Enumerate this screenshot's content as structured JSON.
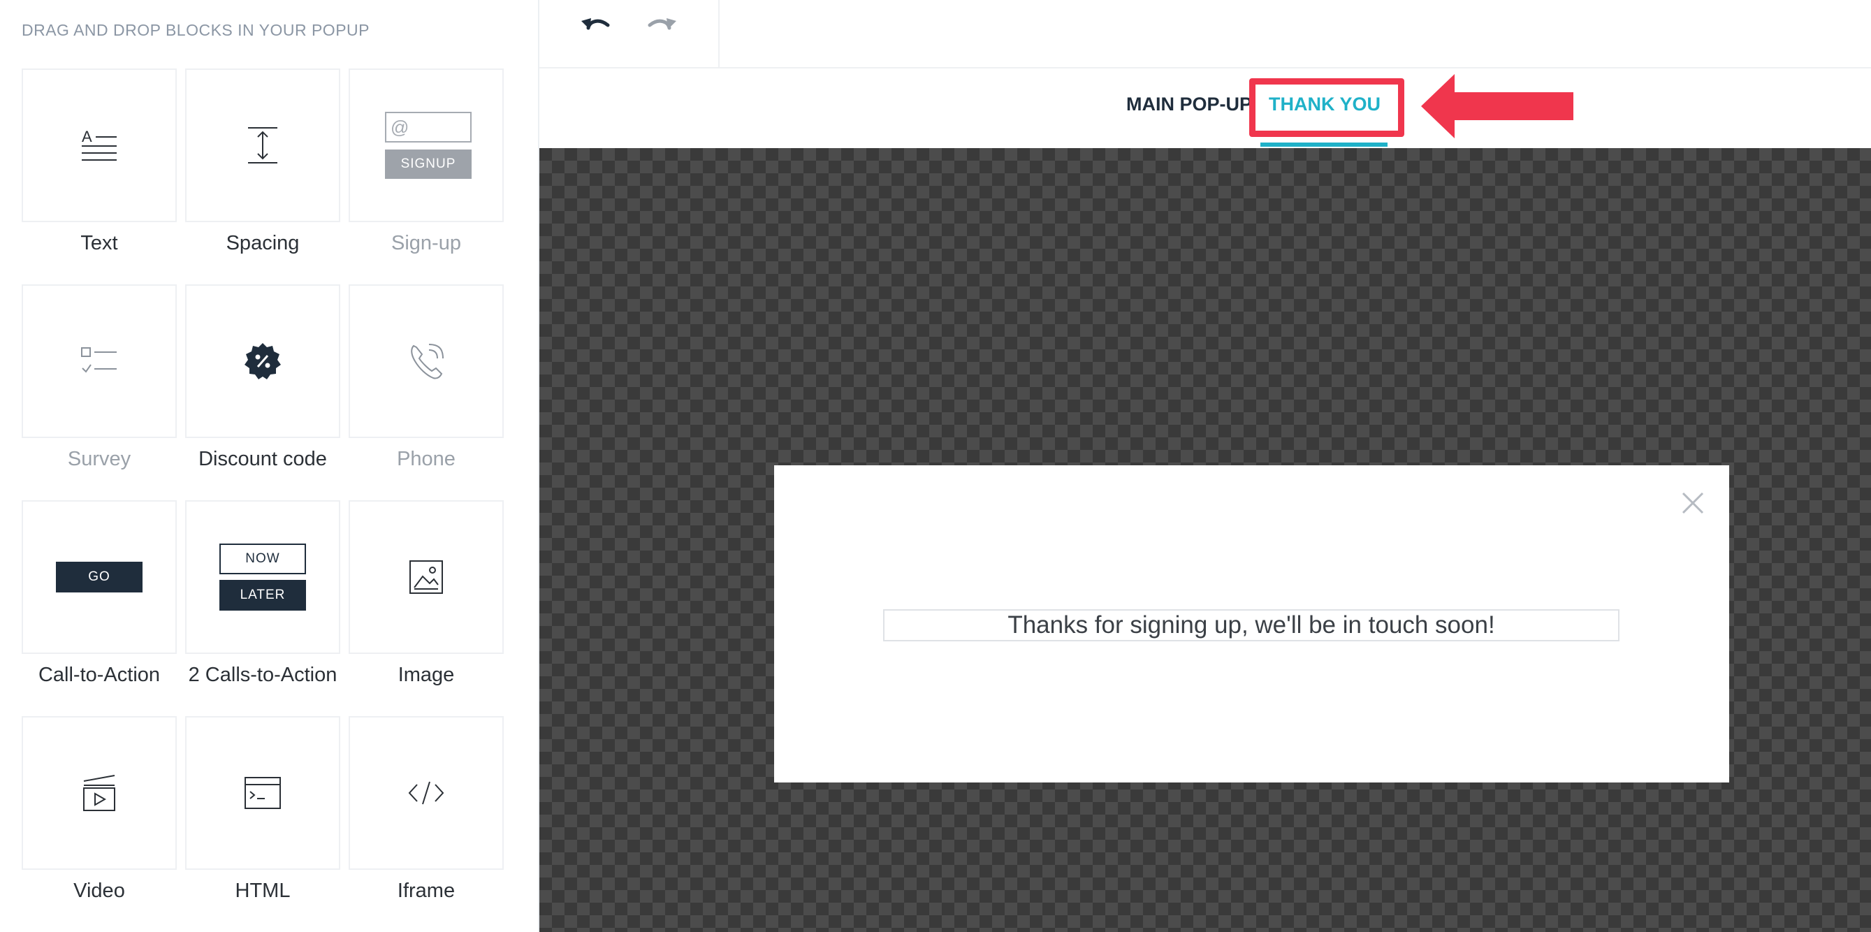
{
  "sidebar": {
    "heading": "DRAG AND DROP BLOCKS IN YOUR POPUP",
    "blocks": [
      {
        "label": "Text",
        "icon": "text-icon"
      },
      {
        "label": "Spacing",
        "icon": "spacing-icon"
      },
      {
        "label": "Sign-up",
        "icon": "signup-icon",
        "mini_input": "@",
        "mini_button": "SIGNUP"
      },
      {
        "label": "Survey",
        "icon": "survey-icon"
      },
      {
        "label": "Discount code",
        "icon": "discount-icon"
      },
      {
        "label": "Phone",
        "icon": "phone-icon"
      },
      {
        "label": "Call-to-Action",
        "icon": "cta-icon",
        "mini_button": "GO"
      },
      {
        "label": "2 Calls-to-Action",
        "icon": "two-cta-icon",
        "mini_button_1": "NOW",
        "mini_button_2": "LATER"
      },
      {
        "label": "Image",
        "icon": "image-icon"
      },
      {
        "label": "Video",
        "icon": "video-icon"
      },
      {
        "label": "HTML",
        "icon": "html-icon"
      },
      {
        "label": "Iframe",
        "icon": "iframe-icon"
      }
    ]
  },
  "toolbar": {
    "undo_icon": "undo-icon",
    "redo_icon": "redo-icon"
  },
  "tabs": [
    {
      "label": "MAIN POP-UP",
      "active": false
    },
    {
      "label": "THANK YOU",
      "active": true
    }
  ],
  "popup": {
    "message": "Thanks for signing up, we'll be in touch soon!",
    "close_icon": "close-icon"
  },
  "colors": {
    "accent": "#1fb1c8",
    "highlight": "#f0364d",
    "dark": "#1f2d3c",
    "canvas_dark": "#3a3a3a",
    "canvas_light": "#4c4c4c"
  }
}
